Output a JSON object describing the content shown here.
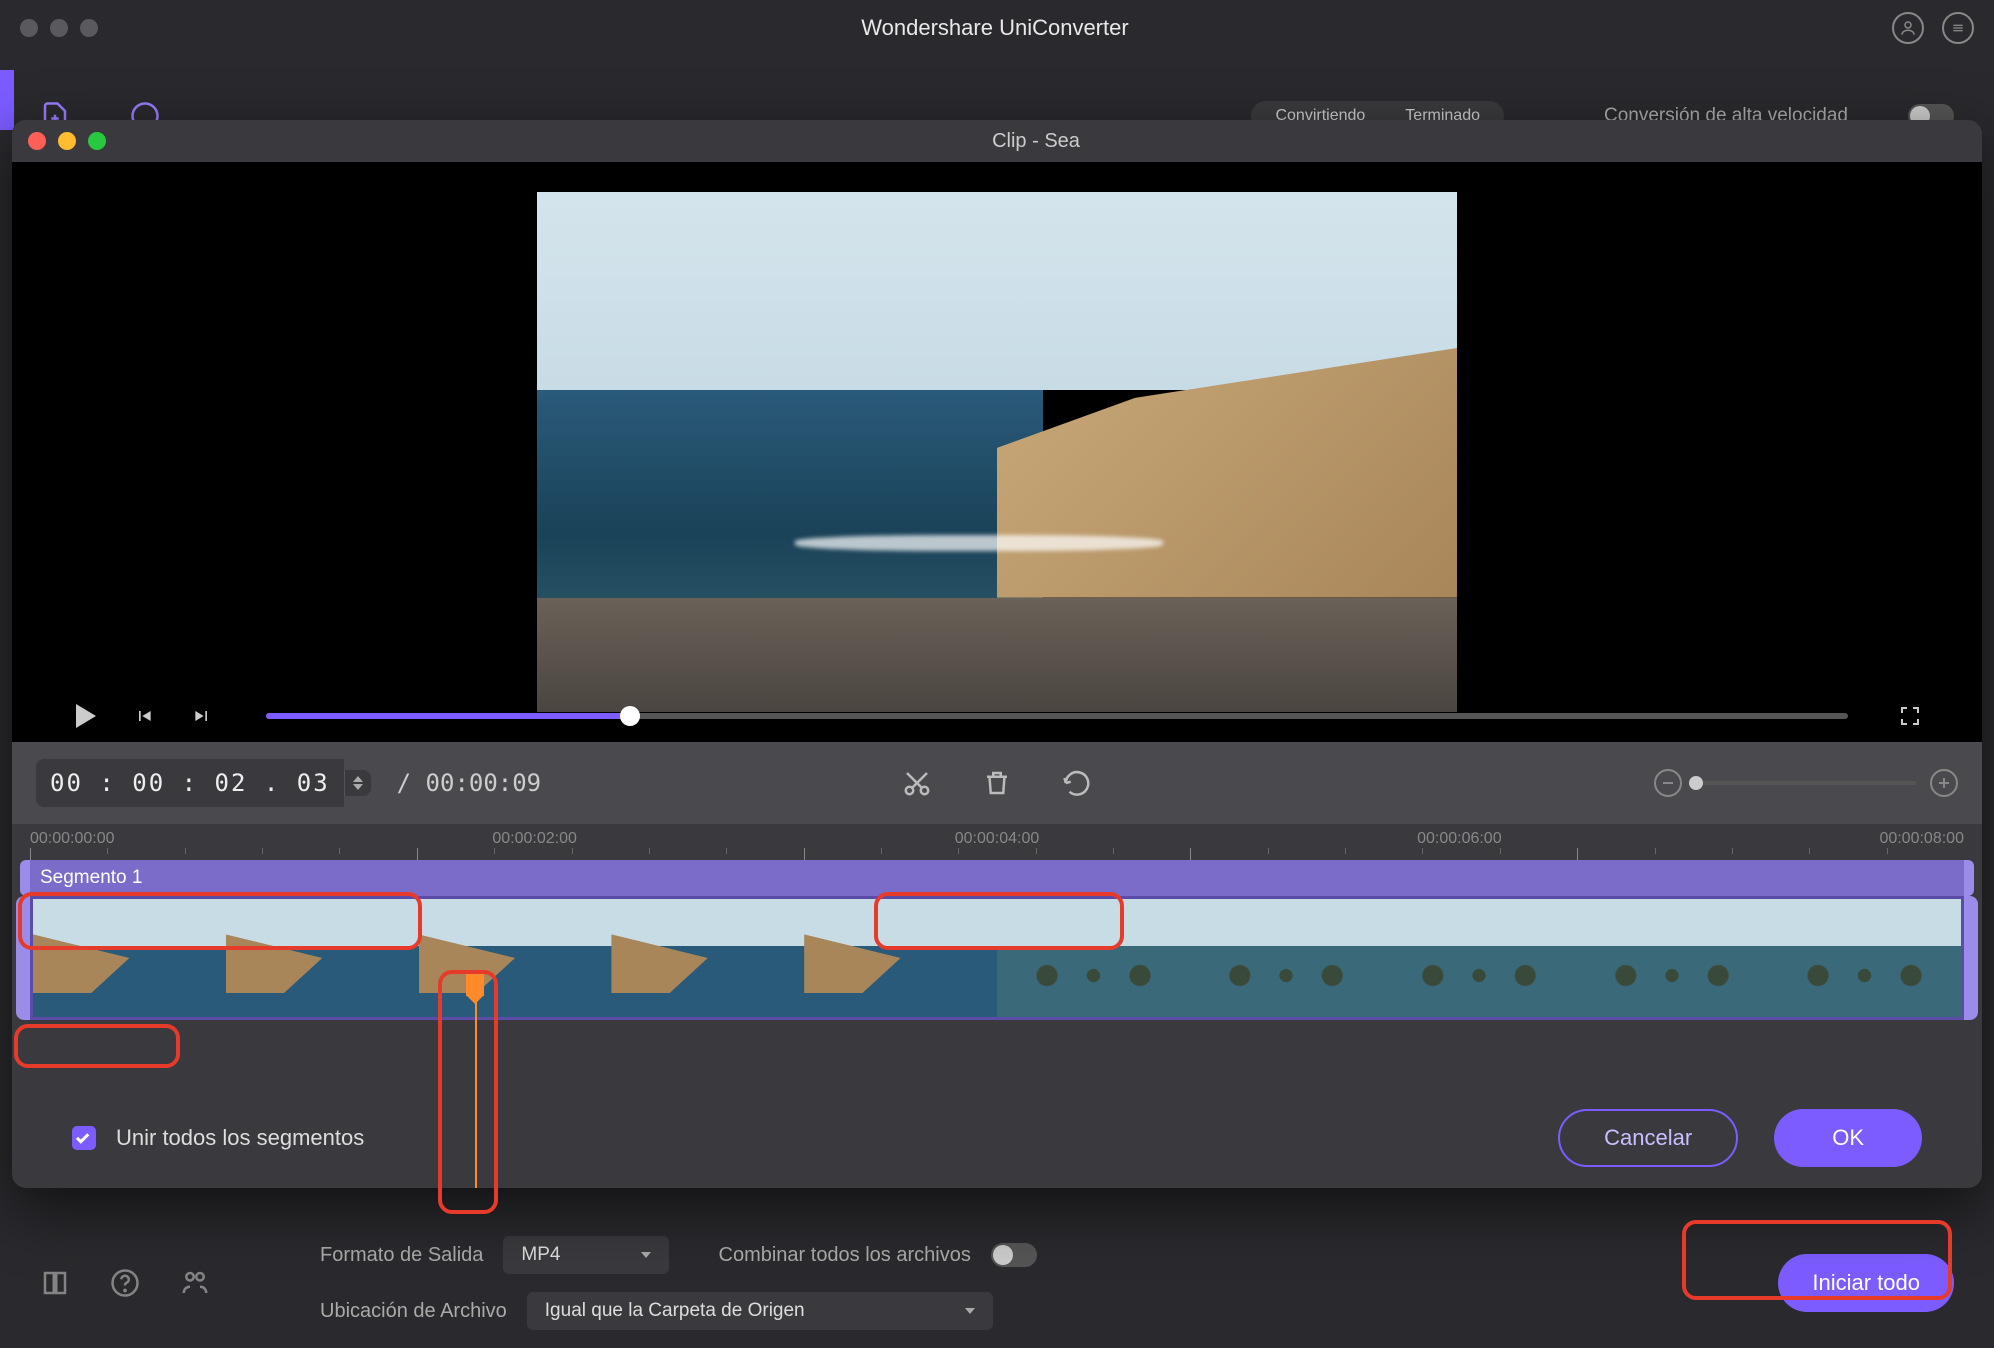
{
  "back": {
    "title": "Wondershare UniConverter",
    "tab1": "Convirtiendo",
    "tab2": "Terminado",
    "hs_label": "Conversión de alta velocidad",
    "format_label": "Formato de Salida",
    "format_value": "MP4",
    "merge_label": "Combinar todos los archivos",
    "location_label": "Ubicación de Archivo",
    "location_value": "Igual que la Carpeta de Origen",
    "start_btn": "Iniciar todo"
  },
  "dialog": {
    "title": "Clip - Sea",
    "time_input": "00 : 00 : 02 . 03",
    "duration": "/ 00:00:09",
    "segment_label": "Segmento 1",
    "merge_check": "Unir todos los segmentos",
    "cancel": "Cancelar",
    "ok": "OK",
    "ruler": {
      "t0": "00:00:00:00",
      "t1": "00:00:02:00",
      "t2": "00:00:04:00",
      "t3": "00:00:06:00",
      "t4": "00:00:08:00"
    }
  }
}
